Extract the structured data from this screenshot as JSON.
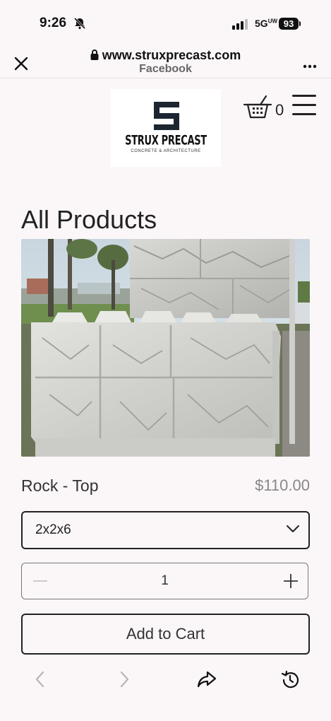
{
  "status_bar": {
    "time": "9:26",
    "network": "5G",
    "network_sup": "UW",
    "battery": "93"
  },
  "browser": {
    "domain": "www.struxprecast.com",
    "subtitle": "Facebook"
  },
  "site": {
    "logo_name": "STRUX PRECAST",
    "logo_tagline": "CONCRETE & ARCHITECTURE",
    "cart_count": "0"
  },
  "page": {
    "title": "All Products"
  },
  "product": {
    "name": "Rock - Top",
    "price": "$110.00",
    "size_selected": "2x2x6",
    "quantity": "1",
    "add_to_cart_label": "Add to Cart"
  },
  "colors": {
    "background": "#fbf7f9",
    "text": "#222222",
    "price": "#888888",
    "logo_bg": "#ffffff"
  },
  "icons": [
    "close-icon",
    "lock-icon",
    "more-icon",
    "cart-icon",
    "menu-icon",
    "chevron-down-icon",
    "minus-icon",
    "plus-icon",
    "back-icon",
    "forward-icon",
    "share-icon",
    "history-icon"
  ]
}
